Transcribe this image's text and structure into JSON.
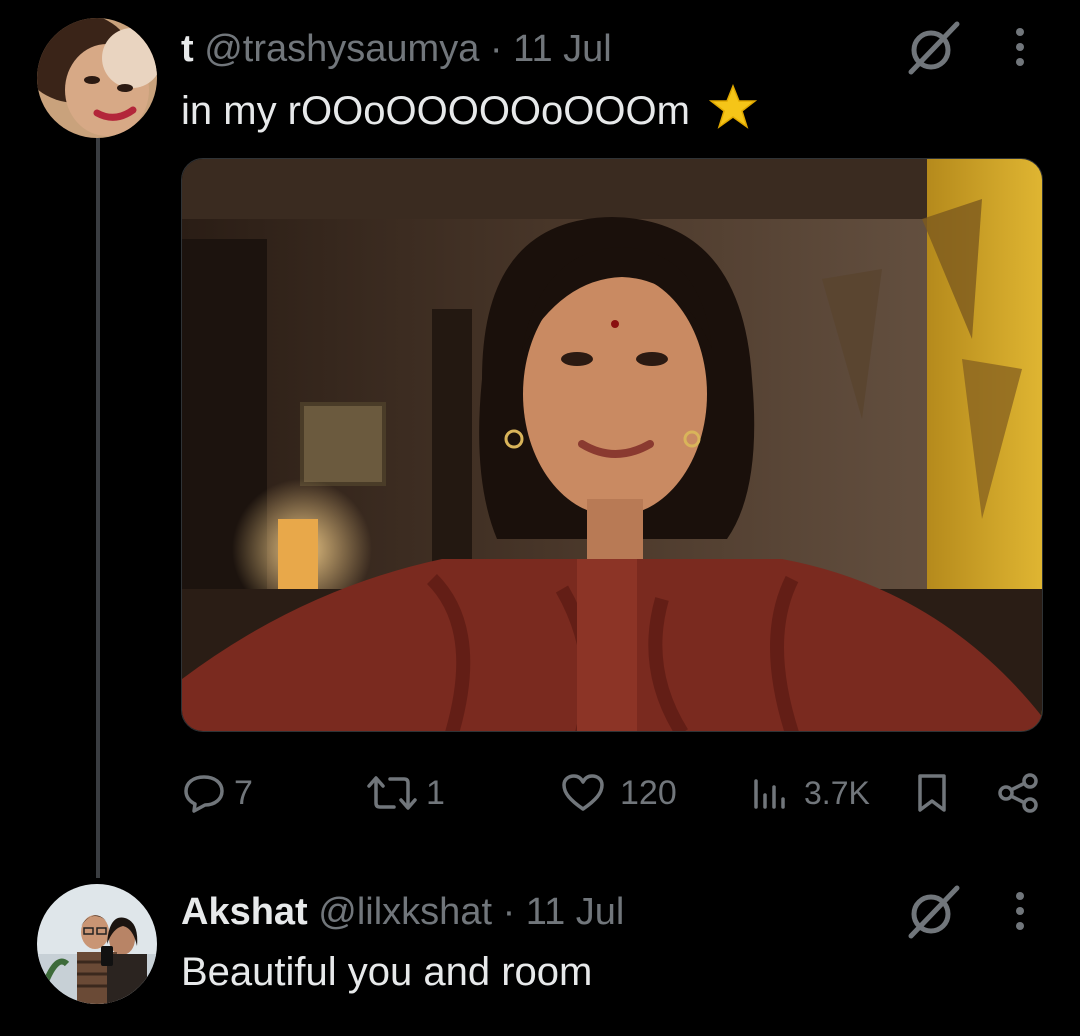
{
  "colors": {
    "background": "#000000",
    "text_primary": "#e7e9ea",
    "text_secondary": "#71767b",
    "thread_line": "#3a3d41",
    "star": "#f5c518"
  },
  "tweet": {
    "display_name": "t",
    "handle": "@trashysaumya",
    "separator": "·",
    "date": "11 Jul",
    "text": "in my rOOoOOOOOoOOOm",
    "emoji": "⭐",
    "media_description_icon": "selfie-photo",
    "actions": {
      "replies": "7",
      "retweets": "1",
      "likes": "120",
      "views": "3.7K"
    }
  },
  "reply": {
    "display_name": "Akshat",
    "handle": "@lilxkshat",
    "separator": "·",
    "date": "11 Jul",
    "text": "Beautiful you and room"
  },
  "icons": {
    "grok": "grok-icon",
    "more": "more-vertical-icon",
    "reply": "reply-icon",
    "retweet": "retweet-icon",
    "like": "heart-icon",
    "views": "views-icon",
    "bookmark": "bookmark-icon",
    "share": "share-icon"
  }
}
